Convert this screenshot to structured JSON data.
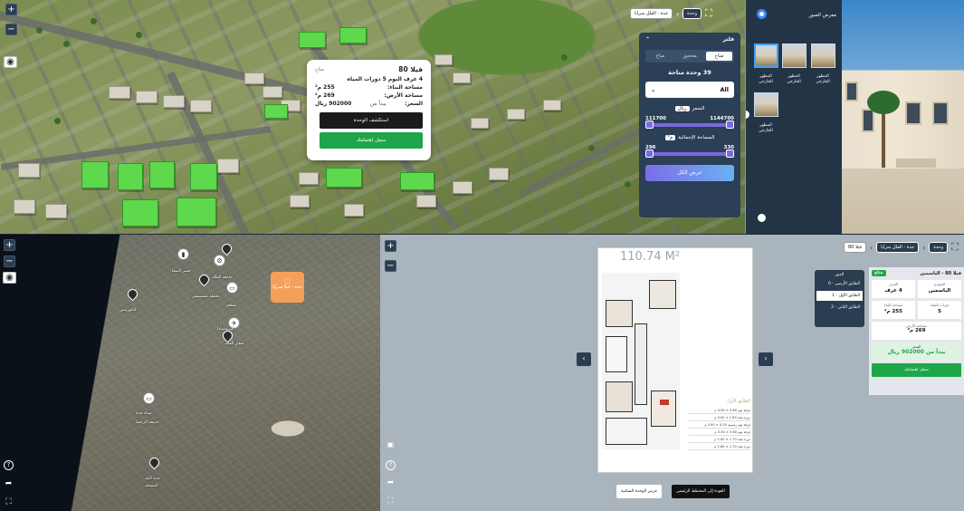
{
  "top_map": {
    "popup": {
      "unit_title": "فيلا 80",
      "status_tag": "متاح",
      "subtitle": "4 غرف النوم 5 دورات المياه",
      "rows": [
        {
          "label": "مساحة البناء:",
          "value": "255 م²"
        },
        {
          "label": "مساحة الأرض:",
          "value": "269 م²"
        },
        {
          "label": "السعر:",
          "prefix": "يبدأ من",
          "value": "902000 ريال"
        }
      ],
      "explore_button": "استكشف الوحدة",
      "register_button": "سجل اهتمامك"
    },
    "breadcrumb": {
      "items": [
        "جدة - الفلل سرايا",
        "وحدة"
      ]
    },
    "filter": {
      "title": "فلتر",
      "tabs": [
        "متاح",
        "محجوز",
        "مباع"
      ],
      "active_tab": "متاح",
      "count_text": "39 وحدة متاحة",
      "select_value": "All",
      "price_label": "السعر",
      "price_chip": "ريال",
      "price_min": "111700",
      "price_max": "1144700",
      "area_label": "المساحة الإجمالية",
      "area_chip": "م²",
      "area_min": "296",
      "area_max": "330",
      "show_all_button": "عرض الكل"
    }
  },
  "gallery": {
    "title": "معرض الصور",
    "thumbs": [
      "المظهر الخارجي",
      "المظهر الخارجي",
      "المظهر الخارجي",
      "المظهر الخارجي"
    ]
  },
  "bottom_map": {
    "orange_marker_label": "جدة - فيلا سرايا",
    "places": [
      "قصر الصفا",
      "جامعة الملك",
      "مطار الملك",
      "محطة مستشفى",
      "الكورنيش",
      "ميناء جدة",
      "جدة البلد",
      "مطعم",
      "البرومينادا",
      "حديقة الرحمة",
      "المسجد"
    ]
  },
  "unit_view": {
    "breadcrumb": [
      "جدة - الفلل سرايا",
      "وحدة",
      "فيلا 80"
    ],
    "floorplan": {
      "area": "110.74 M²",
      "list_title": "الطابق الأول",
      "list": [
        "غرفة نوم 3.60 × 3.60 م",
        "دورة مياه 1.80 × 3.00 م",
        "غرفة نوم رئيسية 4.20 × 3.90 م",
        "غرفة نوم 3.60 × 3.40 م",
        "دورة مياه 1.70 × 2.40 م",
        "دورة مياه 1.70 × 2.80 م"
      ]
    },
    "floors": {
      "title": "الدور",
      "items": [
        "الطابق الأرضي - 0",
        "الطابق الأول - 1",
        "الطابق الثاني - 2"
      ],
      "active": 1
    },
    "info": {
      "name": "فيلا 80 - الياسمين",
      "badge": "متاح",
      "cells": [
        {
          "label": "النموذج",
          "value": "الياسمين"
        },
        {
          "label": "الغرف",
          "value": "4 غرف"
        },
        {
          "label": "دورات المياه",
          "value": "5"
        },
        {
          "label": "مساحة البناء",
          "value": "255 م²"
        }
      ],
      "land_label": "مساحة الأرض",
      "land_value": "269 م²",
      "price_label": "السعر",
      "price_value": "يبدأ من 902000 ريال",
      "register_button": "سجل اهتمامك"
    },
    "back_button": "العودة إلى المخطط الرئيسي",
    "next_unit_button": "عرض الوحدة السكنية"
  }
}
